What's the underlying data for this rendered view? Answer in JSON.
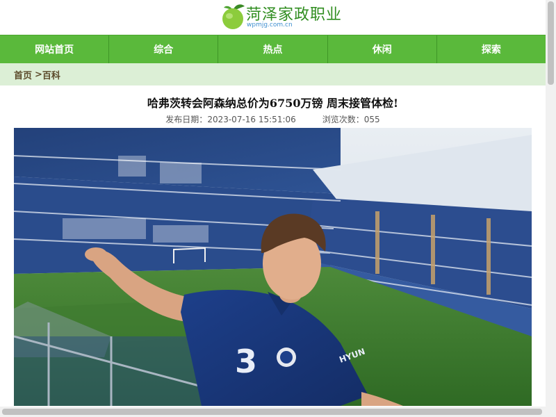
{
  "site": {
    "title": "菏泽家政职业",
    "domain": "wpmjg.com.cn"
  },
  "nav": {
    "items": [
      {
        "label": "网站首页"
      },
      {
        "label": "综合"
      },
      {
        "label": "热点"
      },
      {
        "label": "休闲"
      },
      {
        "label": "探索"
      }
    ]
  },
  "breadcrumb": {
    "home": "首页",
    "separator": ">",
    "current": "百科"
  },
  "article": {
    "title": "哈弗茨转会阿森纳总价为6750万镑 周末接管体检!",
    "date_label": "发布日期：",
    "date": "2023-07-16 15:51:06",
    "views_label": "浏览次数：",
    "views": "055"
  },
  "colors": {
    "nav_green": "#5ab93b",
    "breadcrumb_bg": "#dcefd6",
    "logo_green": "#2f8d1f"
  }
}
